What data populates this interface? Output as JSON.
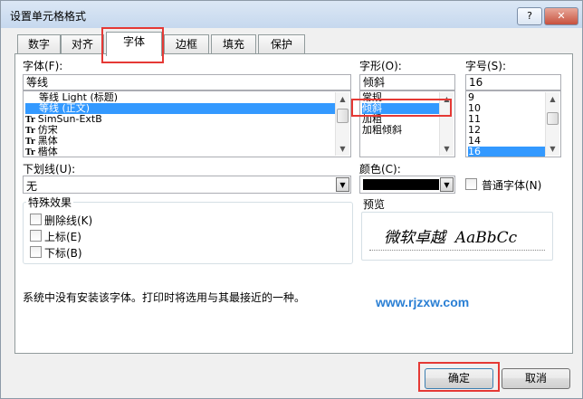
{
  "window": {
    "title": "设置单元格格式",
    "help_glyph": "?",
    "close_glyph": "✕"
  },
  "tabs": [
    "数字",
    "对齐",
    "字体",
    "边框",
    "填充",
    "保护"
  ],
  "font": {
    "label": "字体(F):",
    "value": "等线",
    "items": [
      {
        "text": "等线 Light (标题)",
        "icon": ""
      },
      {
        "text": "等线 (正文)",
        "icon": "",
        "selected": true
      },
      {
        "text": "SimSun-ExtB",
        "icon": "Tr"
      },
      {
        "text": "仿宋",
        "icon": "Tr"
      },
      {
        "text": "黑体",
        "icon": "Tr"
      },
      {
        "text": "楷体",
        "icon": "Tr"
      }
    ]
  },
  "style": {
    "label": "字形(O):",
    "value": "倾斜",
    "items": [
      {
        "text": "常规"
      },
      {
        "text": "倾斜",
        "selected": true
      },
      {
        "text": "加粗"
      },
      {
        "text": "加粗倾斜"
      }
    ]
  },
  "size": {
    "label": "字号(S):",
    "value": "16",
    "items": [
      {
        "text": "9"
      },
      {
        "text": "10"
      },
      {
        "text": "11"
      },
      {
        "text": "12"
      },
      {
        "text": "14"
      },
      {
        "text": "16",
        "selected": true
      }
    ]
  },
  "underline": {
    "label": "下划线(U):",
    "value": "无"
  },
  "color": {
    "label": "颜色(C):",
    "swatch": "#000000"
  },
  "normal_font": {
    "label": "普通字体(N)"
  },
  "effects": {
    "legend": "特殊效果",
    "strikethrough": "删除线(K)",
    "superscript": "上标(E)",
    "subscript": "下标(B)"
  },
  "preview": {
    "legend": "预览",
    "text": "微软卓越  AaBbCc"
  },
  "info": "系统中没有安装该字体。打印时将选用与其最接近的一种。",
  "watermark": "www.rjzxw.com",
  "buttons": {
    "ok": "确定",
    "cancel": "取消"
  },
  "colors": {
    "selection": "#3399ff",
    "highlight_box": "#e53935",
    "watermark": "#2a7fd4"
  }
}
